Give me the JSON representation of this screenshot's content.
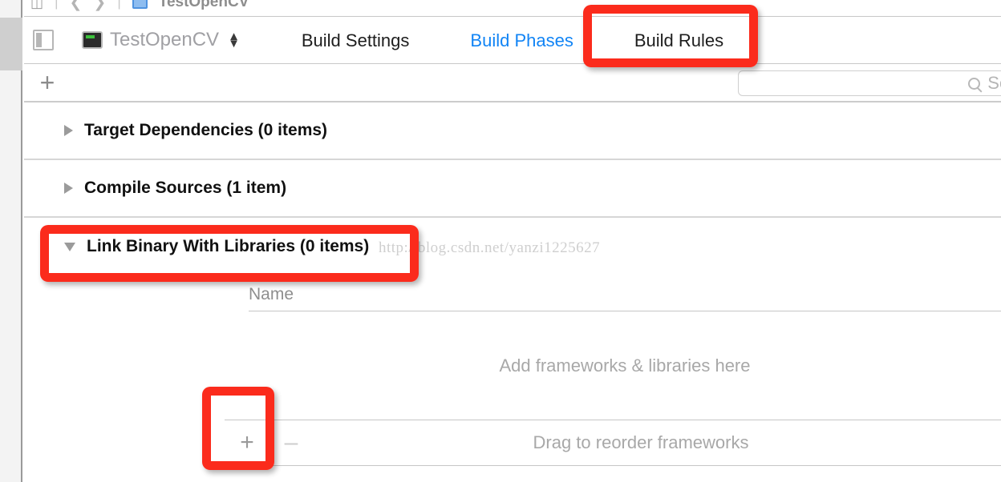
{
  "topnav": {
    "project_title": "TestOpenCV",
    "icons": [
      "panels-icon",
      "back-chevron-icon",
      "forward-chevron-icon",
      "project-document-icon"
    ]
  },
  "tabbar": {
    "panel_toggle_icon": "left-panel-toggle-icon",
    "target": {
      "icon": "app-target-icon",
      "name": "TestOpenCV",
      "stepper_icon": "up-down-stepper-icon"
    },
    "tabs": [
      {
        "label": "Build Settings",
        "active": false
      },
      {
        "label": "Build Phases",
        "active": true
      },
      {
        "label": "Build Rules",
        "active": false
      }
    ]
  },
  "filterbar": {
    "add_phase_icon": "plus-icon",
    "add_phase_label": "+",
    "search": {
      "icon": "search-icon",
      "placeholder": "Search",
      "value": ""
    }
  },
  "phases": [
    {
      "title": "Target Dependencies (0 items)",
      "expanded": false,
      "disclosure_icon": "triangle-right-icon"
    },
    {
      "title": "Compile Sources (1 item)",
      "expanded": false,
      "disclosure_icon": "triangle-right-icon"
    },
    {
      "title": "Link Binary With Libraries (0 items)",
      "expanded": true,
      "disclosure_icon": "triangle-down-icon"
    }
  ],
  "link_binary": {
    "column_header": "Name",
    "empty_hint": "Add frameworks & libraries here",
    "toolbar": {
      "add_label": "+",
      "add_icon": "plus-icon",
      "remove_label": "–",
      "remove_icon": "minus-icon",
      "reorder_hint": "Drag to reorder frameworks"
    }
  },
  "watermark": "http://blog.csdn.net/yanzi1225627",
  "annotations": {
    "color": "#fb2b1c",
    "targets": [
      "build-phases-tab",
      "link-binary-phase-header",
      "add-framework-plus-button"
    ]
  }
}
